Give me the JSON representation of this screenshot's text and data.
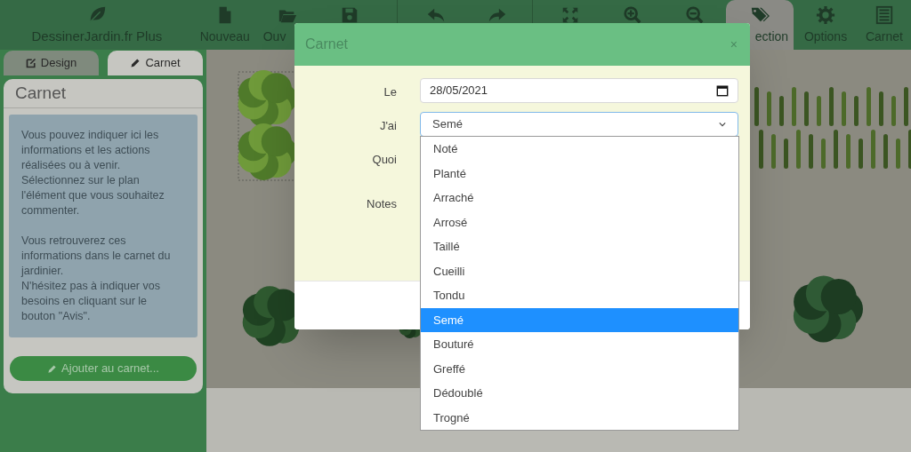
{
  "app": {
    "title": "DessinerJardin.fr Plus"
  },
  "toolbar": [
    {
      "label": "Nouveau",
      "selected": false
    },
    {
      "label": "Ouv",
      "selected": false
    },
    {
      "selected": false
    },
    {
      "selected": false
    },
    {
      "selected": false
    },
    {
      "selected": false
    },
    {
      "selected": false
    },
    {
      "selected": false
    },
    {
      "label": "ection",
      "selected": true
    },
    {
      "label": "Options",
      "selected": false
    },
    {
      "label": "Carnet",
      "selected": false
    }
  ],
  "sidebar": {
    "tabs": [
      {
        "label": "Design",
        "selected": false
      },
      {
        "label": "Carnet",
        "selected": true
      }
    ],
    "panel": {
      "title": "Carnet",
      "paragraphs": [
        "Vous pouvez indiquer ici les informations et les actions réalisées ou à venir. Sélectionnez sur le plan l'élément que vous souhaitez commenter.",
        "Vous retrouverez ces informations dans le carnet du jardinier.",
        "N'hésitez pas à indiquer vos besoins en cliquant sur le bouton \"Avis\"."
      ],
      "button": "Ajouter au carnet..."
    }
  },
  "dialog": {
    "title": "Carnet",
    "close": "×",
    "fields": [
      {
        "label": "Le",
        "kind": "date",
        "value": "28/05/2021"
      },
      {
        "label": "J'ai",
        "kind": "select",
        "value": "Semé",
        "expanded": true,
        "options": [
          {
            "label": "Noté",
            "selected": false
          },
          {
            "label": "Planté",
            "selected": false
          },
          {
            "label": "Arraché",
            "selected": false
          },
          {
            "label": "Arrosé",
            "selected": false
          },
          {
            "label": "Taillé",
            "selected": false
          },
          {
            "label": "Cueilli",
            "selected": false
          },
          {
            "label": "Tondu",
            "selected": false
          },
          {
            "label": "Semé",
            "selected": true
          },
          {
            "label": "Bouturé",
            "selected": false
          },
          {
            "label": "Greffé",
            "selected": false
          },
          {
            "label": "Dédoublé",
            "selected": false
          },
          {
            "label": "Trogné",
            "selected": false
          }
        ]
      },
      {
        "label": "Quoi",
        "kind": "covered"
      },
      {
        "label": "Notes",
        "kind": "covered"
      }
    ]
  }
}
